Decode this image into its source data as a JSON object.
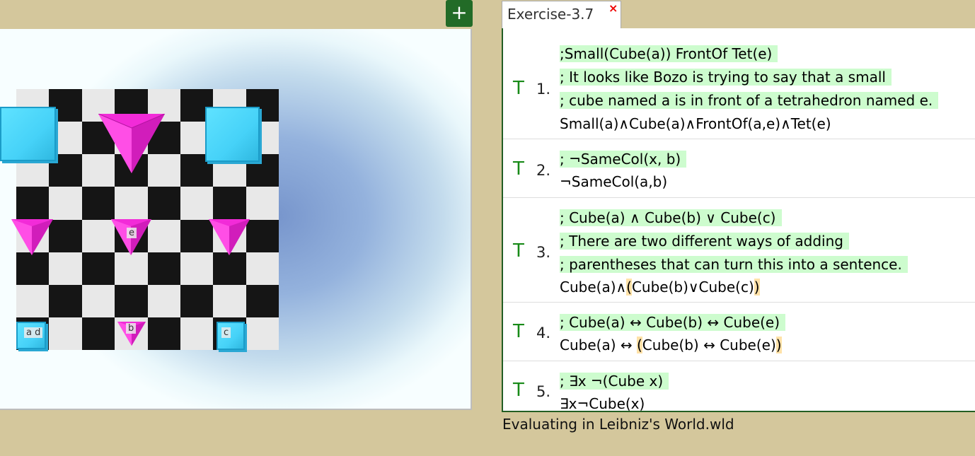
{
  "toolbar": {
    "add_label": "+"
  },
  "tab": {
    "title": "Exercise-3.7",
    "close_label": "×"
  },
  "world": {
    "labels": {
      "a_d": "a d",
      "e": "e",
      "b": "b",
      "c": "c"
    },
    "colors": {
      "cube": "#46d2f8",
      "tet": "#f22bd8",
      "light_square": "#e8e8e8",
      "dark_square": "#151515"
    }
  },
  "proof": {
    "steps": [
      {
        "mark": "T",
        "num": "1.",
        "comments": [
          ";Small(Cube(a)) FrontOf Tet(e)",
          "; It looks like Bozo is trying to say that a small",
          "; cube named a is in front of a tetrahedron named e."
        ],
        "formula": "Small(a)∧Cube(a)∧FrontOf(a,e)∧Tet(e)"
      },
      {
        "mark": "T",
        "num": "2.",
        "comments": [
          "; ¬SameCol(x, b)"
        ],
        "formula": "¬SameCol(a,b)"
      },
      {
        "mark": "T",
        "num": "3.",
        "comments": [
          "; Cube(a) ∧ Cube(b) ∨ Cube(c)",
          "; There are two different ways of adding",
          "; parentheses that can turn this into a sentence."
        ],
        "formula_pre": "Cube(a)∧",
        "formula_open": "(",
        "formula_mid": "Cube(b)∨Cube(c)",
        "formula_close": ")"
      },
      {
        "mark": "T",
        "num": "4.",
        "comments": [
          "; Cube(a) ↔ Cube(b) ↔ Cube(e)"
        ],
        "formula_pre": "Cube(a) ↔ ",
        "formula_open": "(",
        "formula_mid": "Cube(b) ↔ Cube(e)",
        "formula_close": ")"
      },
      {
        "mark": "T",
        "num": "5.",
        "comments": [
          "; ∃x ¬(Cube x)"
        ],
        "formula": "∃x¬Cube(x)"
      }
    ]
  },
  "status": {
    "text": "Evaluating in Leibniz's World.wld"
  }
}
